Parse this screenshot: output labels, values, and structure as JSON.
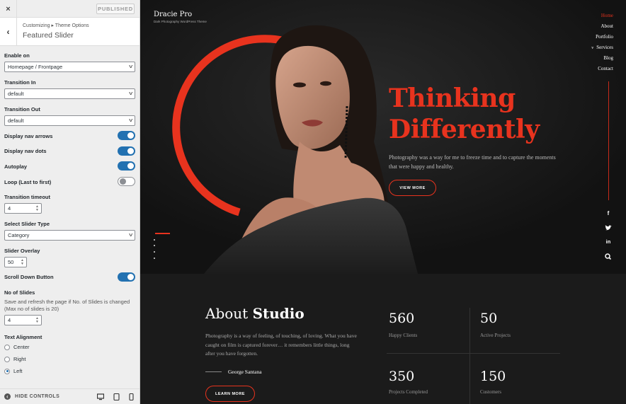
{
  "sidebar": {
    "close_icon": "×",
    "publish_label": "PUBLISHED",
    "breadcrumb": "Customizing ▸ Theme Options",
    "section_title": "Featured Slider",
    "back_icon": "‹",
    "enable_on": {
      "label": "Enable on",
      "value": "Homepage / Frontpage"
    },
    "transition_in": {
      "label": "Transition In",
      "value": "default"
    },
    "transition_out": {
      "label": "Transition Out",
      "value": "default"
    },
    "toggles": [
      {
        "label": "Display nav arrows",
        "on": true
      },
      {
        "label": "Display nav dots",
        "on": true
      },
      {
        "label": "Autoplay",
        "on": true
      },
      {
        "label": "Loop (Last to first)",
        "on": false
      }
    ],
    "transition_timeout": {
      "label": "Transition timeout",
      "value": "4"
    },
    "slider_type": {
      "label": "Select Slider Type",
      "value": "Category"
    },
    "slider_overlay": {
      "label": "Slider Overlay",
      "value": "50"
    },
    "scroll_down": {
      "label": "Scroll Down Button",
      "on": true
    },
    "no_of_slides": {
      "label": "No of Slides",
      "description": "Save and refresh the page if No. of Slides is changed (Max no of slides is 20)",
      "value": "4"
    },
    "text_alignment": {
      "label": "Text Alignment",
      "options": [
        "Center",
        "Right",
        "Left"
      ],
      "selected": "Left"
    },
    "footer": {
      "hide_controls": "HIDE CONTROLS"
    }
  },
  "preview": {
    "site_title": "Dracie Pro",
    "site_tagline": "Dark Photography WordPress Theme",
    "nav": [
      "Home",
      "About",
      "Portfolio",
      "Services",
      "Blog",
      "Contact"
    ],
    "nav_active": "Home",
    "social_icons": [
      "facebook-icon",
      "twitter-icon",
      "linkedin-icon",
      "search-icon"
    ],
    "hero": {
      "title_line1": "Thinking",
      "title_line2": "Differently",
      "text": "Photography was a way for me to freeze time and to capture the moments that were happy and healthy.",
      "button": "VIEW MORE"
    },
    "about": {
      "title_light": "About",
      "title_bold": "Studio",
      "text": "Photography is a way of feeling, of touching, of loving. What you have caught on film is captured forever… it remembers little things, long after you have forgotten.",
      "signature": "George Santana",
      "button": "LEARN MORE",
      "stats": [
        {
          "value": "560",
          "label": "Happy Clients"
        },
        {
          "value": "50",
          "label": "Active Projects"
        },
        {
          "value": "350",
          "label": "Projects Completed"
        },
        {
          "value": "150",
          "label": "Customers"
        }
      ]
    },
    "colors": {
      "accent": "#e8331e",
      "toggle_on": "#2271b1",
      "bg_dark": "#151515"
    }
  }
}
